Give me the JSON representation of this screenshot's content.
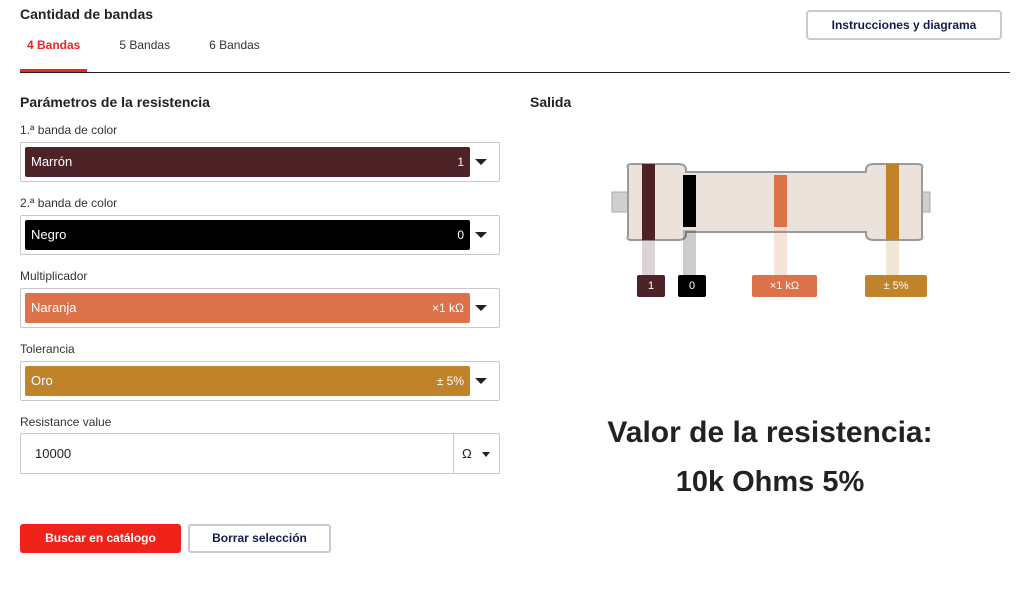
{
  "header": {
    "title": "Cantidad de bandas",
    "tabs": [
      {
        "label": "4 Bandas",
        "active": true
      },
      {
        "label": "5 Bandas",
        "active": false
      },
      {
        "label": "6 Bandas",
        "active": false
      }
    ],
    "instructions_button": "Instrucciones y diagrama"
  },
  "params": {
    "title": "Parámetros de la resistencia",
    "fields": [
      {
        "label": "1.ª banda de color",
        "color_name": "Marrón",
        "value": "1",
        "color": "#4e2327"
      },
      {
        "label": "2.ª banda de color",
        "color_name": "Negro",
        "value": "0",
        "color": "#000000"
      },
      {
        "label": "Multiplicador",
        "color_name": "Naranja",
        "value": "×1 kΩ",
        "color": "#dc7249"
      },
      {
        "label": "Tolerancia",
        "color_name": "Oro",
        "value": "± 5%",
        "color": "#c0832a"
      }
    ],
    "resistance_value": {
      "label": "Resistance value",
      "value": "10000",
      "unit": "Ω"
    }
  },
  "output": {
    "title": "Salida",
    "band_labels": [
      "1",
      "0",
      "×1 kΩ",
      "± 5%"
    ],
    "result_title": "Valor de la resistencia:",
    "result_value": "10k Ohms 5%"
  },
  "actions": {
    "search_button": "Buscar en catálogo",
    "clear_button": "Borrar selección"
  },
  "colors": {
    "accent": "#f0231a",
    "navy": "#141b4d",
    "resistor_body": "#ebe3db"
  }
}
